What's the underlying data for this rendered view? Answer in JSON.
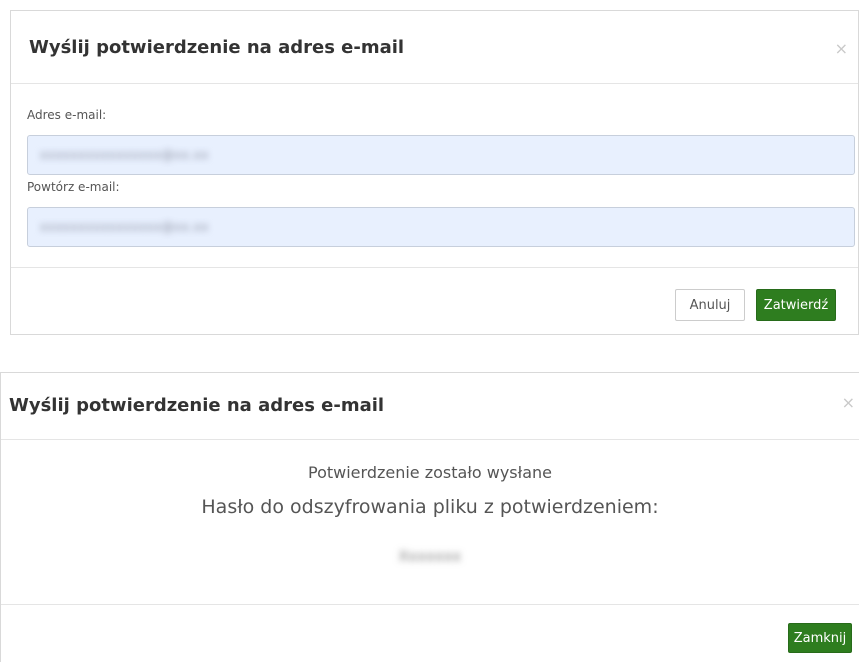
{
  "dialog_form": {
    "title": "Wyślij potwierdzenie na adres e-mail",
    "close_glyph": "×",
    "email_label": "Adres e-mail:",
    "email_value": "xxxxxxxxxxxxxxxx@xx.xx",
    "repeat_label": "Powtórz e-mail:",
    "repeat_value": "xxxxxxxxxxxxxxxx@xx.xx",
    "cancel_label": "Anuluj",
    "submit_label": "Zatwierdź"
  },
  "dialog_result": {
    "title": "Wyślij potwierdzenie na adres e-mail",
    "close_glyph": "×",
    "sent_message": "Potwierdzenie zostało wysłane",
    "password_label": "Hasło do odszyfrowania pliku z potwierdzeniem:",
    "password_value": "Xxxxxxx",
    "close_label": "Zamknij"
  },
  "colors": {
    "primary_button": "#2e7d1f",
    "input_background": "#e8f0fe",
    "border": "#d9d9d9"
  }
}
